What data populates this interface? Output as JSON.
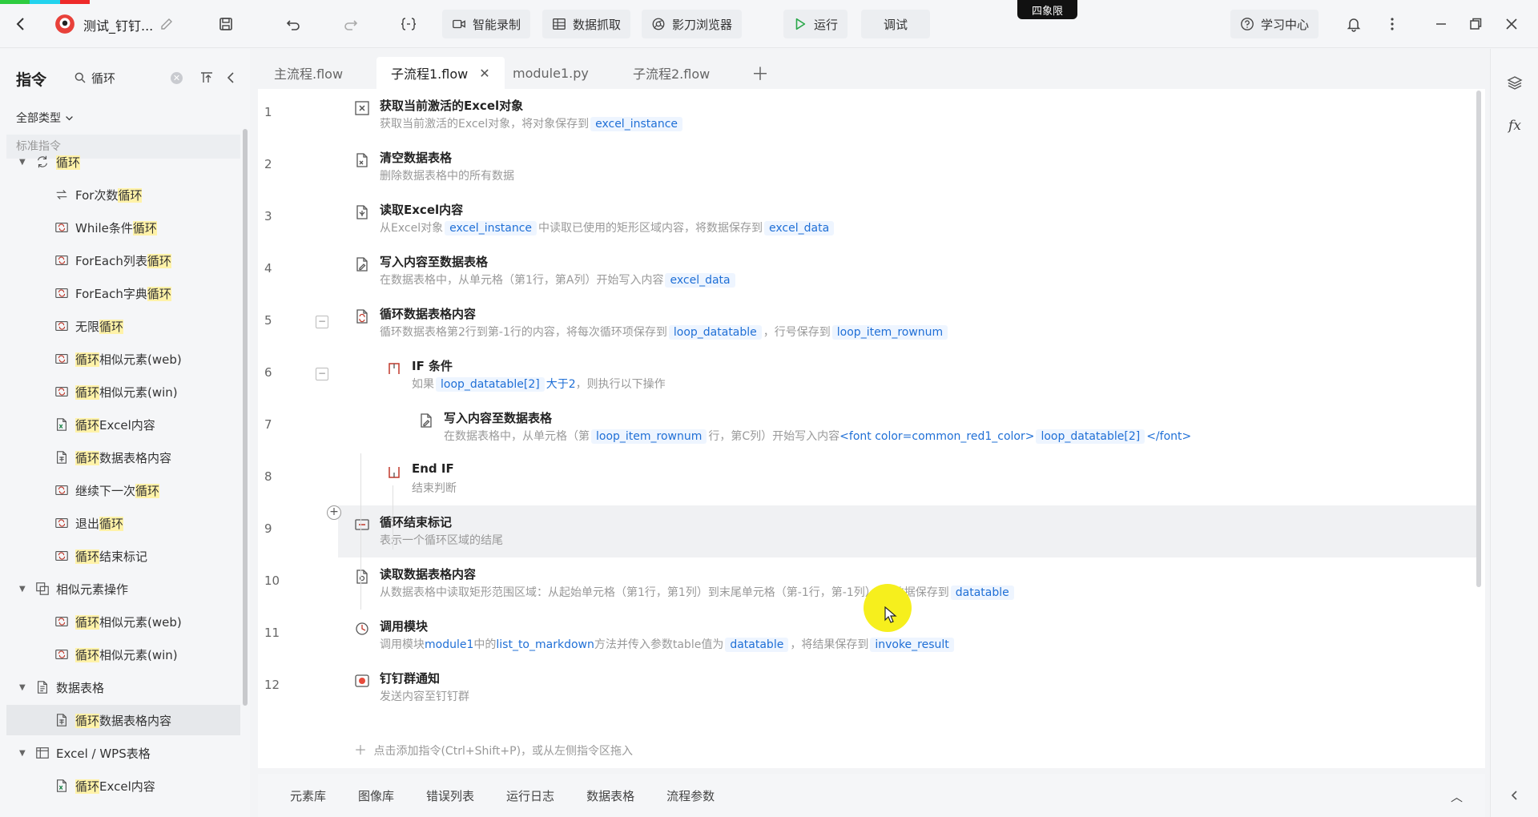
{
  "window": {
    "title": "测试_钉钉...",
    "badge": "四象限",
    "color_strip": [
      "#2ecc40",
      "#22d3ee",
      "#ee2a2a"
    ]
  },
  "toolbar": {
    "record_label": "智能录制",
    "grab_label": "数据抓取",
    "browser_label": "影刀浏览器",
    "run_label": "运行",
    "debug_label": "调试",
    "learn_label": "学习中心"
  },
  "left_panel": {
    "title": "指令",
    "search_value": "循环",
    "type_filter": "全部类型",
    "section_header": "标准指令",
    "highlight_color": "#fff2a8"
  },
  "tree": [
    {
      "level": 0,
      "expanded": true,
      "icon": "loop-icon",
      "pre": "",
      "hl": "循环",
      "post": ""
    },
    {
      "level": 1,
      "icon": "for-loop-icon",
      "pre": "For次数",
      "hl": "循环",
      "post": ""
    },
    {
      "level": 1,
      "icon": "loop-cmd-icon",
      "pre": "While条件",
      "hl": "循环",
      "post": ""
    },
    {
      "level": 1,
      "icon": "loop-cmd-icon",
      "pre": "ForEach列表",
      "hl": "循环",
      "post": ""
    },
    {
      "level": 1,
      "icon": "loop-cmd-icon",
      "pre": "ForEach字典",
      "hl": "循环",
      "post": ""
    },
    {
      "level": 1,
      "icon": "loop-cmd-icon",
      "pre": "无限",
      "hl": "循环",
      "post": ""
    },
    {
      "level": 1,
      "icon": "loop-cmd-icon",
      "pre": "",
      "hl": "循环",
      "post": "相似元素(web)"
    },
    {
      "level": 1,
      "icon": "loop-cmd-icon",
      "pre": "",
      "hl": "循环",
      "post": "相似元素(win)"
    },
    {
      "level": 1,
      "icon": "excel-doc-icon",
      "pre": "",
      "hl": "循环",
      "post": "Excel内容"
    },
    {
      "level": 1,
      "icon": "table-doc-icon",
      "pre": "",
      "hl": "循环",
      "post": "数据表格内容"
    },
    {
      "level": 1,
      "icon": "loop-cmd-icon",
      "pre": "继续下一次",
      "hl": "循环",
      "post": ""
    },
    {
      "level": 1,
      "icon": "loop-cmd-icon",
      "pre": "退出",
      "hl": "循环",
      "post": ""
    },
    {
      "level": 1,
      "icon": "loop-cmd-icon",
      "pre": "",
      "hl": "循环",
      "post": "结束标记"
    },
    {
      "level": 0,
      "expanded": true,
      "icon": "similar-element-icon",
      "pre": "相似元素操作",
      "hl": "",
      "post": ""
    },
    {
      "level": 1,
      "icon": "loop-cmd-icon",
      "pre": "",
      "hl": "循环",
      "post": "相似元素(web)"
    },
    {
      "level": 1,
      "icon": "loop-cmd-icon",
      "pre": "",
      "hl": "循环",
      "post": "相似元素(win)"
    },
    {
      "level": 0,
      "expanded": true,
      "icon": "datatable-icon",
      "pre": "数据表格",
      "hl": "",
      "post": ""
    },
    {
      "level": 1,
      "selected": true,
      "icon": "table-doc-icon",
      "pre": "",
      "hl": "循环",
      "post": "数据表格内容"
    },
    {
      "level": 0,
      "expanded": true,
      "icon": "excel-group-icon",
      "pre": "Excel / WPS表格",
      "hl": "",
      "post": ""
    },
    {
      "level": 1,
      "icon": "excel-doc-icon",
      "pre": "",
      "hl": "循环",
      "post": "Excel内容"
    }
  ],
  "tabs": [
    {
      "label": "主流程.flow",
      "active": false
    },
    {
      "label": "子流程1.flow",
      "active": true
    },
    {
      "label": "module1.py",
      "active": false
    },
    {
      "label": "子流程2.flow",
      "active": false
    }
  ],
  "flow": [
    {
      "num": "1",
      "indent": 0,
      "icon": "excel-object-icon",
      "title": "获取当前激活的Excel对象",
      "desc": [
        {
          "t": "获取当前激活的Excel对象，将对象保存到"
        },
        {
          "v": "excel_instance"
        }
      ]
    },
    {
      "num": "2",
      "indent": 0,
      "icon": "clear-table-icon",
      "title": "清空数据表格",
      "desc": [
        {
          "t": "删除数据表格中的所有数据"
        }
      ]
    },
    {
      "num": "3",
      "indent": 0,
      "icon": "read-excel-icon",
      "title": "读取Excel内容",
      "desc": [
        {
          "t": "从Excel对象"
        },
        {
          "v": "excel_instance"
        },
        {
          "t": "中读取已使用的矩形区域内容，将数据保存到"
        },
        {
          "v": "excel_data"
        }
      ]
    },
    {
      "num": "4",
      "indent": 0,
      "icon": "write-table-icon",
      "title": "写入内容至数据表格",
      "desc": [
        {
          "t": "在数据表格中，从单元格（第1行，第A列）开始写入内容"
        },
        {
          "v": "excel_data"
        }
      ]
    },
    {
      "num": "5",
      "indent": 0,
      "collapse": true,
      "icon": "loop-table-icon",
      "title": "循环数据表格内容",
      "desc": [
        {
          "t": "循环数据表格第2行到第-1行的内容，将每次循环项保存到"
        },
        {
          "v": "loop_datatable"
        },
        {
          "t": "，行号保存到"
        },
        {
          "v": "loop_item_rownum"
        }
      ]
    },
    {
      "num": "6",
      "indent": 1,
      "collapse": true,
      "icon": "if-icon",
      "title": "IF 条件",
      "desc": [
        {
          "t": "如果"
        },
        {
          "v": "loop_datatable[2]"
        },
        {
          "b": "大于2"
        },
        {
          "t": "，则执行以下操作"
        }
      ]
    },
    {
      "num": "7",
      "indent": 2,
      "icon": "write-table-icon",
      "title": "写入内容至数据表格",
      "desc": [
        {
          "t": "在数据表格中，从单元格（第"
        },
        {
          "v": "loop_item_rownum"
        },
        {
          "t": "行，第C列）开始写入内容"
        },
        {
          "b": "<font color=common_red1_color>"
        },
        {
          "v": "loop_datatable[2]"
        },
        {
          "b": "</font>"
        }
      ]
    },
    {
      "num": "8",
      "indent": 1,
      "icon": "end-if-icon",
      "title": "End IF",
      "desc": [
        {
          "t": "结束判断"
        }
      ]
    },
    {
      "num": "9",
      "indent": 0,
      "hover": true,
      "icon": "loop-end-icon",
      "title": "循环结束标记",
      "desc": [
        {
          "t": "表示一个循环区域的结尾"
        }
      ]
    },
    {
      "num": "10",
      "indent": 0,
      "icon": "read-table-icon",
      "title": "读取数据表格内容",
      "desc": [
        {
          "t": "从数据表格中读取矩形范围区域：从起始单元格（第1行，第1列）到末尾单元格（第-1行，第-1列），将数据保存到"
        },
        {
          "v": "datatable"
        }
      ]
    },
    {
      "num": "11",
      "indent": 0,
      "icon": "invoke-module-icon",
      "title": "调用模块",
      "desc": [
        {
          "t": "调用模块"
        },
        {
          "b": "module1"
        },
        {
          "t": "中的"
        },
        {
          "b": "list_to_markdown"
        },
        {
          "t": "方法并传入参数table值为"
        },
        {
          "v": "datatable"
        },
        {
          "t": "，将结果保存到"
        },
        {
          "v": "invoke_result"
        }
      ]
    },
    {
      "num": "12",
      "indent": 0,
      "icon": "dingtalk-notify-icon",
      "title": "钉钉群通知",
      "desc": [
        {
          "t": "发送内容至钉钉群"
        }
      ]
    }
  ],
  "add_hint": "点击添加指令(Ctrl+Shift+P)，或从左侧指令区拖入",
  "bottom_tabs": [
    "元素库",
    "图像库",
    "错误列表",
    "运行日志",
    "数据表格",
    "流程参数"
  ],
  "colors": {
    "accent": "#1f6fd6",
    "var_bg": "#eef5ff",
    "cursor_highlight": "#f6ef1d"
  }
}
